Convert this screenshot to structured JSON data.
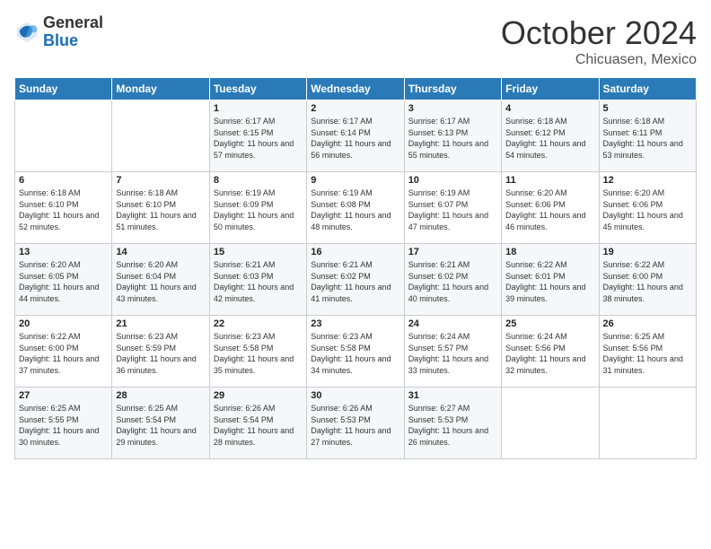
{
  "logo": {
    "general": "General",
    "blue": "Blue"
  },
  "header": {
    "month": "October 2024",
    "location": "Chicuasen, Mexico"
  },
  "weekdays": [
    "Sunday",
    "Monday",
    "Tuesday",
    "Wednesday",
    "Thursday",
    "Friday",
    "Saturday"
  ],
  "weeks": [
    [
      {
        "day": "",
        "sunrise": "",
        "sunset": "",
        "daylight": ""
      },
      {
        "day": "",
        "sunrise": "",
        "sunset": "",
        "daylight": ""
      },
      {
        "day": "1",
        "sunrise": "Sunrise: 6:17 AM",
        "sunset": "Sunset: 6:15 PM",
        "daylight": "Daylight: 11 hours and 57 minutes."
      },
      {
        "day": "2",
        "sunrise": "Sunrise: 6:17 AM",
        "sunset": "Sunset: 6:14 PM",
        "daylight": "Daylight: 11 hours and 56 minutes."
      },
      {
        "day": "3",
        "sunrise": "Sunrise: 6:17 AM",
        "sunset": "Sunset: 6:13 PM",
        "daylight": "Daylight: 11 hours and 55 minutes."
      },
      {
        "day": "4",
        "sunrise": "Sunrise: 6:18 AM",
        "sunset": "Sunset: 6:12 PM",
        "daylight": "Daylight: 11 hours and 54 minutes."
      },
      {
        "day": "5",
        "sunrise": "Sunrise: 6:18 AM",
        "sunset": "Sunset: 6:11 PM",
        "daylight": "Daylight: 11 hours and 53 minutes."
      }
    ],
    [
      {
        "day": "6",
        "sunrise": "Sunrise: 6:18 AM",
        "sunset": "Sunset: 6:10 PM",
        "daylight": "Daylight: 11 hours and 52 minutes."
      },
      {
        "day": "7",
        "sunrise": "Sunrise: 6:18 AM",
        "sunset": "Sunset: 6:10 PM",
        "daylight": "Daylight: 11 hours and 51 minutes."
      },
      {
        "day": "8",
        "sunrise": "Sunrise: 6:19 AM",
        "sunset": "Sunset: 6:09 PM",
        "daylight": "Daylight: 11 hours and 50 minutes."
      },
      {
        "day": "9",
        "sunrise": "Sunrise: 6:19 AM",
        "sunset": "Sunset: 6:08 PM",
        "daylight": "Daylight: 11 hours and 48 minutes."
      },
      {
        "day": "10",
        "sunrise": "Sunrise: 6:19 AM",
        "sunset": "Sunset: 6:07 PM",
        "daylight": "Daylight: 11 hours and 47 minutes."
      },
      {
        "day": "11",
        "sunrise": "Sunrise: 6:20 AM",
        "sunset": "Sunset: 6:06 PM",
        "daylight": "Daylight: 11 hours and 46 minutes."
      },
      {
        "day": "12",
        "sunrise": "Sunrise: 6:20 AM",
        "sunset": "Sunset: 6:06 PM",
        "daylight": "Daylight: 11 hours and 45 minutes."
      }
    ],
    [
      {
        "day": "13",
        "sunrise": "Sunrise: 6:20 AM",
        "sunset": "Sunset: 6:05 PM",
        "daylight": "Daylight: 11 hours and 44 minutes."
      },
      {
        "day": "14",
        "sunrise": "Sunrise: 6:20 AM",
        "sunset": "Sunset: 6:04 PM",
        "daylight": "Daylight: 11 hours and 43 minutes."
      },
      {
        "day": "15",
        "sunrise": "Sunrise: 6:21 AM",
        "sunset": "Sunset: 6:03 PM",
        "daylight": "Daylight: 11 hours and 42 minutes."
      },
      {
        "day": "16",
        "sunrise": "Sunrise: 6:21 AM",
        "sunset": "Sunset: 6:02 PM",
        "daylight": "Daylight: 11 hours and 41 minutes."
      },
      {
        "day": "17",
        "sunrise": "Sunrise: 6:21 AM",
        "sunset": "Sunset: 6:02 PM",
        "daylight": "Daylight: 11 hours and 40 minutes."
      },
      {
        "day": "18",
        "sunrise": "Sunrise: 6:22 AM",
        "sunset": "Sunset: 6:01 PM",
        "daylight": "Daylight: 11 hours and 39 minutes."
      },
      {
        "day": "19",
        "sunrise": "Sunrise: 6:22 AM",
        "sunset": "Sunset: 6:00 PM",
        "daylight": "Daylight: 11 hours and 38 minutes."
      }
    ],
    [
      {
        "day": "20",
        "sunrise": "Sunrise: 6:22 AM",
        "sunset": "Sunset: 6:00 PM",
        "daylight": "Daylight: 11 hours and 37 minutes."
      },
      {
        "day": "21",
        "sunrise": "Sunrise: 6:23 AM",
        "sunset": "Sunset: 5:59 PM",
        "daylight": "Daylight: 11 hours and 36 minutes."
      },
      {
        "day": "22",
        "sunrise": "Sunrise: 6:23 AM",
        "sunset": "Sunset: 5:58 PM",
        "daylight": "Daylight: 11 hours and 35 minutes."
      },
      {
        "day": "23",
        "sunrise": "Sunrise: 6:23 AM",
        "sunset": "Sunset: 5:58 PM",
        "daylight": "Daylight: 11 hours and 34 minutes."
      },
      {
        "day": "24",
        "sunrise": "Sunrise: 6:24 AM",
        "sunset": "Sunset: 5:57 PM",
        "daylight": "Daylight: 11 hours and 33 minutes."
      },
      {
        "day": "25",
        "sunrise": "Sunrise: 6:24 AM",
        "sunset": "Sunset: 5:56 PM",
        "daylight": "Daylight: 11 hours and 32 minutes."
      },
      {
        "day": "26",
        "sunrise": "Sunrise: 6:25 AM",
        "sunset": "Sunset: 5:56 PM",
        "daylight": "Daylight: 11 hours and 31 minutes."
      }
    ],
    [
      {
        "day": "27",
        "sunrise": "Sunrise: 6:25 AM",
        "sunset": "Sunset: 5:55 PM",
        "daylight": "Daylight: 11 hours and 30 minutes."
      },
      {
        "day": "28",
        "sunrise": "Sunrise: 6:25 AM",
        "sunset": "Sunset: 5:54 PM",
        "daylight": "Daylight: 11 hours and 29 minutes."
      },
      {
        "day": "29",
        "sunrise": "Sunrise: 6:26 AM",
        "sunset": "Sunset: 5:54 PM",
        "daylight": "Daylight: 11 hours and 28 minutes."
      },
      {
        "day": "30",
        "sunrise": "Sunrise: 6:26 AM",
        "sunset": "Sunset: 5:53 PM",
        "daylight": "Daylight: 11 hours and 27 minutes."
      },
      {
        "day": "31",
        "sunrise": "Sunrise: 6:27 AM",
        "sunset": "Sunset: 5:53 PM",
        "daylight": "Daylight: 11 hours and 26 minutes."
      },
      {
        "day": "",
        "sunrise": "",
        "sunset": "",
        "daylight": ""
      },
      {
        "day": "",
        "sunrise": "",
        "sunset": "",
        "daylight": ""
      }
    ]
  ]
}
